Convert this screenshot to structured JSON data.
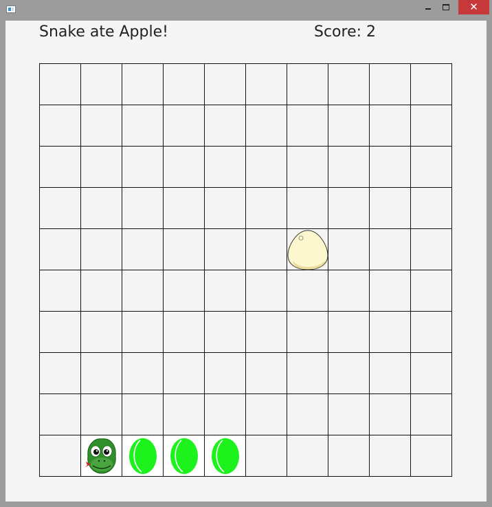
{
  "window": {
    "minimize_glyph": "minimize-icon",
    "maximize_glyph": "maximize-icon",
    "close_glyph": "✕"
  },
  "header": {
    "status_text": "Snake ate Apple!",
    "score_text": "Score: 2"
  },
  "board": {
    "columns": 10,
    "rows": 10,
    "snake_head": {
      "col": 2,
      "row": 10,
      "icon": "snake-head-icon"
    },
    "snake_body": [
      {
        "col": 3,
        "row": 10,
        "icon": "snake-body-segment-icon"
      },
      {
        "col": 4,
        "row": 10,
        "icon": "snake-body-segment-icon"
      },
      {
        "col": 5,
        "row": 10,
        "icon": "snake-body-segment-icon"
      }
    ],
    "food": {
      "col": 7,
      "row": 5,
      "icon": "egg-icon"
    }
  },
  "colors": {
    "body_green": "#1df21d",
    "head_green": "#2f8f2a",
    "egg_fill": "#fcf7cf",
    "egg_shade": "#e8dd9a",
    "close_red": "#c7383a"
  }
}
